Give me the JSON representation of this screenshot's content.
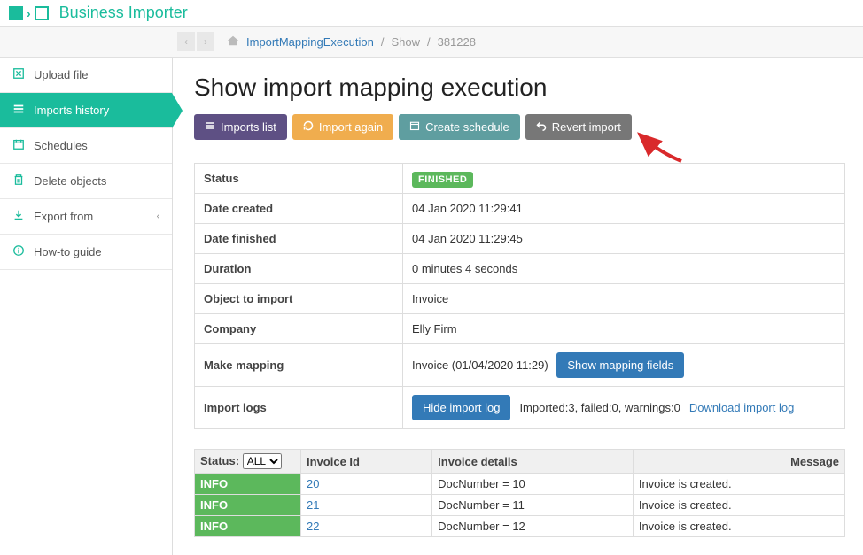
{
  "app_name": "Business Importer",
  "breadcrumb": {
    "link": "ImportMappingExecution",
    "show": "Show",
    "id": "381228"
  },
  "sidebar": {
    "upload": "Upload file",
    "imports_history": "Imports history",
    "schedules": "Schedules",
    "delete_objects": "Delete objects",
    "export_from": "Export from",
    "howto": "How-to guide"
  },
  "page_title": "Show import mapping execution",
  "buttons": {
    "imports_list": "Imports list",
    "import_again": "Import again",
    "create_schedule": "Create schedule",
    "revert_import": "Revert import",
    "show_mapping_fields": "Show mapping fields",
    "hide_import_log": "Hide import log"
  },
  "info": {
    "status_label": "Status",
    "status_value": "FINISHED",
    "date_created_label": "Date created",
    "date_created_value": "04 Jan 2020 11:29:41",
    "date_finished_label": "Date finished",
    "date_finished_value": "04 Jan 2020 11:29:45",
    "duration_label": "Duration",
    "duration_value": "0 minutes 4 seconds",
    "object_label": "Object to import",
    "object_value": "Invoice",
    "company_label": "Company",
    "company_value": "Elly Firm",
    "mapping_label": "Make mapping",
    "mapping_value": "Invoice (01/04/2020 11:29)",
    "logs_label": "Import logs",
    "logs_summary": "Imported:3, failed:0, warnings:0",
    "download_log": "Download import log"
  },
  "log_table": {
    "status_header": "Status:",
    "filter_value": "ALL",
    "col_invoice_id": "Invoice Id",
    "col_invoice_details": "Invoice details",
    "col_message": "Message",
    "rows": [
      {
        "status": "INFO",
        "id": "20",
        "details": "DocNumber = 10",
        "message": "Invoice is created."
      },
      {
        "status": "INFO",
        "id": "21",
        "details": "DocNumber = 11",
        "message": "Invoice is created."
      },
      {
        "status": "INFO",
        "id": "22",
        "details": "DocNumber = 12",
        "message": "Invoice is created."
      }
    ]
  }
}
